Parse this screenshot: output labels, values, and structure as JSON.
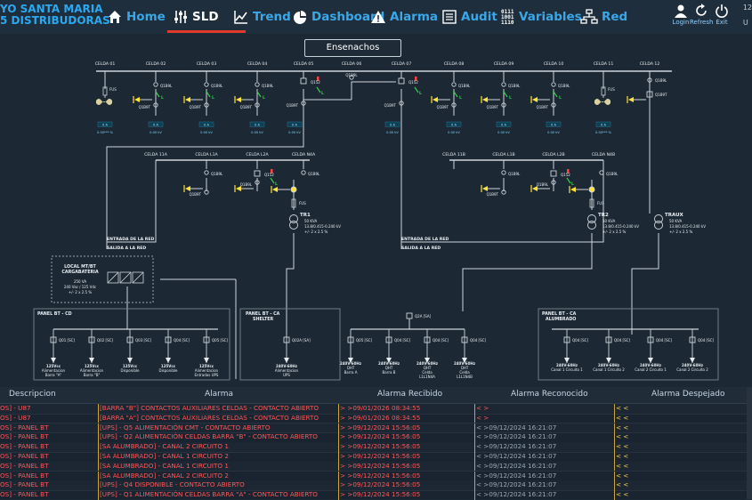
{
  "app": {
    "brand_line1": "YO SANTA MARIA",
    "brand_line2": "5 DISTRIBUDORAS\"",
    "clipped_right": "12"
  },
  "nav": [
    {
      "label": "Home",
      "icon": "home-icon",
      "active": false
    },
    {
      "label": "SLD",
      "icon": "sliders-icon",
      "active": true
    },
    {
      "label": "Trend",
      "icon": "trend-chart-icon",
      "active": false
    },
    {
      "label": "Dashboard",
      "icon": "pie-chart-icon",
      "active": false
    },
    {
      "label": "Alarma",
      "icon": "warning-icon",
      "active": false
    },
    {
      "label": "Audit",
      "icon": "audit-list-icon",
      "active": false
    },
    {
      "label": "Variables",
      "icon": "binary-icon",
      "active": false
    },
    {
      "label": "Red",
      "icon": "network-icon",
      "active": false
    }
  ],
  "tools": {
    "login": "Login",
    "refresh": "Refresh",
    "exit": "Exit",
    "clipped": "U"
  },
  "diagram": {
    "title": "Ensenachos",
    "celdas_top": [
      "CELDA 01",
      "CELDA 02",
      "CELDA 03",
      "CELDA 04",
      "CELDA 05",
      "CELDA 06",
      "CELDA 07",
      "CELDA 08",
      "CELDA 09",
      "CELDA 10",
      "CELDA 11",
      "CELDA 12"
    ],
    "celdas_mid_left": [
      "CELDA 11A",
      "CELDA L1A",
      "CELDA L2A",
      "CELDA N4A"
    ],
    "celdas_mid_right": [
      "CELDA 11B",
      "CELDA L1B",
      "CELDA L2B",
      "CELDA N4B"
    ],
    "fus": "FUS",
    "q1": "Q1B9L",
    "q2": "Q1B9T",
    "q152": "Q152",
    "l": "L",
    "meter_a": "0 A",
    "meter_kv": "0.00 kV",
    "meter_pct": "0.00 %",
    "meter_pct2": "0.00*** %",
    "tr1": {
      "name": "TR1",
      "l1": "50 KVA",
      "l2": "13.8/0.415-0.240 kV",
      "l3": "+/- 2 x 2.5 %"
    },
    "tr2": {
      "name": "TR2",
      "l1": "50 KVA",
      "l2": "13.8/0.415-0.240 kV",
      "l3": "+/- 2 x 2.5 %"
    },
    "traux": {
      "name": "TRAUX",
      "l1": "50 KVA",
      "l2": "13.8/0.415-0.240 kV",
      "l3": "+/- 2 x 2.5 %"
    },
    "entrada": "ENTRADA DE LA RED",
    "salida": "SALIDA A LA RED",
    "local": {
      "l1": "LOCAL MT/BT",
      "l2": "CARGABATERIA",
      "l3": "250 VA",
      "l4": "240 Vac / 125 Vdc",
      "l5": "+/- 2 x 2.5 %"
    },
    "panel_cd": "PANEL BT - CD",
    "panel_ca_shelter": "PANEL BT - CA",
    "panel_ca_shelter2": "SHELTER",
    "panel_alumbrado": "PANEL BT - CA",
    "panel_alumbrado2": "ALUMBRADO",
    "q2a": "Q2A [SA]",
    "cd_breakers": [
      "Q01 [SC]",
      "Q02 [SC]",
      "Q03 [SC]",
      "Q04 [SC]",
      "Q05 [SC]"
    ],
    "cd_loads": [
      {
        "l1": "125Vcc",
        "l2": "Alimentacion",
        "l3": "Barra \"A\""
      },
      {
        "l1": "125Vcc",
        "l2": "Alimentacion",
        "l3": "Barra \"B\""
      },
      {
        "l1": "125Vcc",
        "l2": "Disponible",
        "l3": ""
      },
      {
        "l1": "125Vcc",
        "l2": "Disponible",
        "l3": ""
      },
      {
        "l1": "125Vcc",
        "l2": "Alimentacion",
        "l3": "Entradas UPS"
      }
    ],
    "shelter_breaker": "Q02A [SA]",
    "shelter_load": {
      "l1": "240V-60Hz",
      "l2": "Alimentacion",
      "l3": "UPS"
    },
    "q2a_breakers": [
      "Q05 [SC]",
      "Q04 [SC]",
      "Q04 [SC]",
      "Q04 [SC]"
    ],
    "q2a_loads": [
      {
        "l1": "240V-60Hz",
        "l2": "QHT",
        "l3": "Barra A",
        "l4": ""
      },
      {
        "l1": "240V-60Hz",
        "l2": "QHT",
        "l3": "Barra B",
        "l4": ""
      },
      {
        "l1": "240V-60Hz",
        "l2": "QHT",
        "l3": "Celda",
        "l4": "L1L1N4A"
      },
      {
        "l1": "240V-60Hz",
        "l2": "QHT",
        "l3": "Celda",
        "l4": "L1L1N4B"
      }
    ],
    "alum_breakers": [
      "Q04 [SC]",
      "Q04 [SC]",
      "Q04 [SC]",
      "Q04 [SC]"
    ],
    "alum_loads": [
      {
        "l1": "240V-60Hz",
        "l2": "Canal 1 Circuito 1"
      },
      {
        "l1": "240V-60Hz",
        "l2": "Canal 1 Circuito 2"
      },
      {
        "l1": "240V-60Hz",
        "l2": "Canal 2 Circuito 1"
      },
      {
        "l1": "240V-60Hz",
        "l2": "Canal 2 Circuito 2"
      }
    ]
  },
  "alarm_table": {
    "headers": [
      "Descripcion",
      "Alarma",
      "Alarma Recibido",
      "Alarma Reconocido",
      "Alarma Despejado"
    ],
    "rows": [
      {
        "desc": "OS] - U87",
        "alarma": "[BARRA \"B\"] CONTACTOS AUXILIARES CELDAS - CONTACTO ABIERTO",
        "recibido": "> >09/01/2026 08:34:55",
        "reconocido": "< >",
        "despejado": "< <",
        "rec_red": true
      },
      {
        "desc": "OS] - U87",
        "alarma": "[BARRA \"A\"] CONTACTOS AUXILIARES CELDAS - CONTACTO ABIERTO",
        "recibido": "> >09/01/2026 08:34:55",
        "reconocido": "< >",
        "despejado": "< <",
        "rec_red": true
      },
      {
        "desc": "OS] - PANEL BT",
        "alarma": "[UPS] - Q5 ALIMENTACIÓN CMT - CONTACTO ABIERTO",
        "recibido": "> >09/12/2024 15:56:05",
        "reconocido": "< >09/12/2024 16:21:07",
        "despejado": "< <",
        "rec_red": false
      },
      {
        "desc": "OS] - PANEL BT",
        "alarma": "[UPS] - Q2 ALIMENTACIÓN CELDAS BARRA \"B\" - CONTACTO ABIERTO",
        "recibido": "> >09/12/2024 15:56:05",
        "reconocido": "< >09/12/2024 16:21:07",
        "despejado": "< <",
        "rec_red": false
      },
      {
        "desc": "OS] - PANEL BT",
        "alarma": "[SA ALUMBRADO] - CANAL 2 CIRCUITO 1",
        "recibido": "> >09/12/2024 15:56:05",
        "reconocido": "< >09/12/2024 16:21:07",
        "despejado": "< <",
        "rec_red": false
      },
      {
        "desc": "OS] - PANEL BT",
        "alarma": "[SA ALUMBRADO] - CANAL 1 CIRCUITO 2",
        "recibido": "> >09/12/2024 15:56:05",
        "reconocido": "< >09/12/2024 16:21:07",
        "despejado": "< <",
        "rec_red": false
      },
      {
        "desc": "OS] - PANEL BT",
        "alarma": "[SA ALUMBRADO] - CANAL 1 CIRCUITO 1",
        "recibido": "> >09/12/2024 15:56:05",
        "reconocido": "< >09/12/2024 16:21:07",
        "despejado": "< <",
        "rec_red": false
      },
      {
        "desc": "OS] - PANEL BT",
        "alarma": "[SA ALUMBRADO] - CANAL 2 CIRCUITO 2",
        "recibido": "> >09/12/2024 15:56:05",
        "reconocido": "< >09/12/2024 16:21:07",
        "despejado": "< <",
        "rec_red": false
      },
      {
        "desc": "OS] - PANEL BT",
        "alarma": "[UPS] - Q4 DISPONIBLE - CONTACTO ABIERTO",
        "recibido": "> >09/12/2024 15:56:05",
        "reconocido": "< >09/12/2024 16:21:07",
        "despejado": "< <",
        "rec_red": false
      },
      {
        "desc": "OS] - PANEL BT",
        "alarma": "[UPS] - Q1 ALIMENTACIÓN CELDAS BARRA \"A\" - CONTACTO ABIERTO",
        "recibido": "> >09/12/2024 15:56:05",
        "reconocido": "< >09/12/2024 16:21:07",
        "despejado": "< <",
        "rec_red": false
      }
    ]
  },
  "colors": {
    "accent": "#3aa8e8",
    "alarm_red": "#ff5757",
    "warn_yellow": "#ffd84a",
    "line": "#d0d6dc",
    "breaker_green": "#35d04a",
    "node_yellow": "#ffe23a"
  }
}
